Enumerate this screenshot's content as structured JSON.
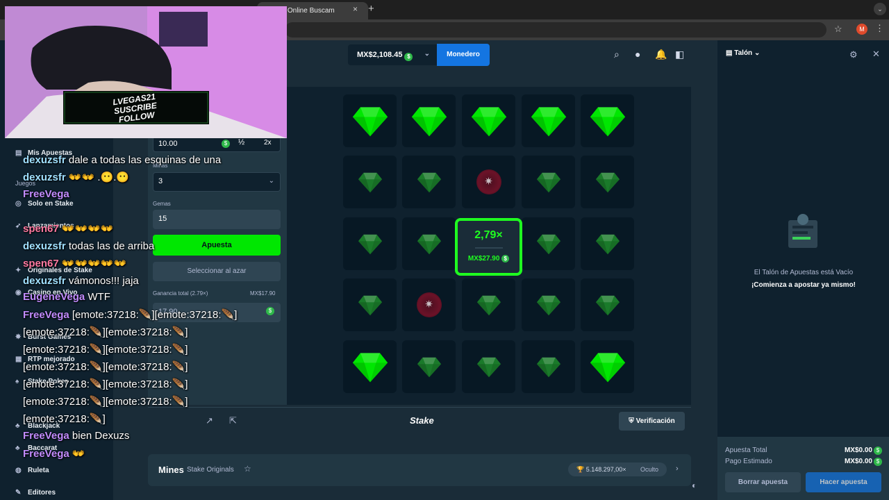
{
  "browser": {
    "tab_title": "- Jugar Online Buscam",
    "tab_close": "×",
    "new_tab": "+",
    "menu": "⌄",
    "profile_initial": "M"
  },
  "sidebar": {
    "my_bets": "Mis Apuestas",
    "games_heading": "Juegos",
    "items": [
      {
        "label": "Solo en Stake",
        "icon": "stake-icon"
      },
      {
        "label": "Lanzamientos",
        "icon": "rocket-icon"
      },
      {
        "label": "Originales de Stake",
        "icon": "fire-icon"
      },
      {
        "label": "Casino en Vivo",
        "icon": "live-icon"
      },
      {
        "label": "Burst Games",
        "icon": "burst-icon"
      },
      {
        "label": "RTP mejorado",
        "icon": "rtp-icon"
      },
      {
        "label": "Stake Poker",
        "icon": "poker-icon"
      },
      {
        "label": "Blackjack",
        "icon": "cards-icon"
      },
      {
        "label": "Baccarat",
        "icon": "cards-icon"
      },
      {
        "label": "Ruleta",
        "icon": "roulette-icon"
      },
      {
        "label": "Editores",
        "icon": "editors-icon"
      }
    ]
  },
  "topbar": {
    "balance": "MX$2,108.45",
    "currency_symbol": "$",
    "wallet_button": "Monedero"
  },
  "controls": {
    "bet_amount": "10.00",
    "half_button": "½",
    "double_button": "2x",
    "mines_label": "Minas",
    "mines_value": "3",
    "gems_label": "Gemas",
    "gems_value": "15",
    "bet_button": "Apuesta",
    "random_button": "Seleccionar al azar",
    "total_profit_label": "Ganancia total (2.79×)",
    "total_profit_value": "MX$17.90",
    "profit_field": "17.90"
  },
  "board": {
    "rows": [
      [
        "gem-revealed",
        "gem-revealed",
        "gem-revealed",
        "gem-revealed",
        "gem-revealed"
      ],
      [
        "gem",
        "gem",
        "bomb",
        "gem",
        "gem"
      ],
      [
        "gem",
        "gem",
        "win",
        "gem",
        "gem"
      ],
      [
        "gem",
        "bomb",
        "gem",
        "gem",
        "gem"
      ],
      [
        "gem-revealed",
        "gem",
        "gem",
        "gem",
        "gem-revealed"
      ]
    ],
    "win_multiplier": "2,79×",
    "win_amount": "MX$27.90",
    "gem_color": "#00e701",
    "gem_dim_color": "#1a7a2a"
  },
  "footer": {
    "logo": "Stake",
    "verify_button": "Verificación"
  },
  "game_info": {
    "title": "Mines",
    "subtitle": "Stake Originals",
    "record": "5.148.297,00×",
    "record_status": "Oculto"
  },
  "betslip": {
    "title": "Talón",
    "empty_title": "El Talón de Apuestas está Vacío",
    "empty_cta": "¡Comienza a apostar ya mismo!",
    "total_bet_label": "Apuesta Total",
    "total_bet_value": "MX$0.00",
    "est_payout_label": "Pago Estimado",
    "est_payout_value": "MX$0.00",
    "clear_button": "Borrar apuesta",
    "place_button": "Hacer apuesta"
  },
  "webcam": {
    "banner_line1": "LVEGAS21",
    "banner_line2": "SUSCRIBE",
    "banner_line3": "FOLLOW"
  },
  "chat": [
    {
      "user": "dexuzsfr",
      "text": "dale a todas las esquinas de una",
      "color": "#a0e0ff"
    },
    {
      "user": "dexuzsfr",
      "text": "👐👐 .😶.😶",
      "color": "#a0e0ff"
    },
    {
      "user": "FreeVega",
      "text": "",
      "color": "#c28cff"
    },
    {
      "user": "spen67",
      "text": "👐👐👐👐",
      "color": "#ff7aa2"
    },
    {
      "user": "dexuzsfr",
      "text": "todas las de arriba",
      "color": "#a0e0ff"
    },
    {
      "user": "spen67",
      "text": "👐👐👐👐👐",
      "color": "#ff7aa2"
    },
    {
      "user": "dexuzsfr",
      "text": "vámonos!!! jaja",
      "color": "#a0e0ff"
    },
    {
      "user": "EugeneVega",
      "text": "WTF",
      "color": "#c28cff"
    },
    {
      "user": "FreeVega",
      "text": "[emote:37218:🪶][emote:37218:🪶]",
      "color": "#c28cff"
    },
    {
      "user": "",
      "text": "[emote:37218:🪶][emote:37218:🪶]",
      "color": "#ffffff"
    },
    {
      "user": "",
      "text": "[emote:37218:🪶][emote:37218:🪶]",
      "color": "#ffffff"
    },
    {
      "user": "",
      "text": "[emote:37218:🪶][emote:37218:🪶]",
      "color": "#ffffff"
    },
    {
      "user": "",
      "text": "[emote:37218:🪶][emote:37218:🪶]",
      "color": "#ffffff"
    },
    {
      "user": "",
      "text": "[emote:37218:🪶][emote:37218:🪶]",
      "color": "#ffffff"
    },
    {
      "user": "",
      "text": "[emote:37218:🪶]",
      "color": "#ffffff"
    },
    {
      "user": "FreeVega",
      "text": "bien Dexuzs",
      "color": "#c28cff"
    },
    {
      "user": "FreeVega",
      "text": "👐",
      "color": "#c28cff"
    }
  ]
}
